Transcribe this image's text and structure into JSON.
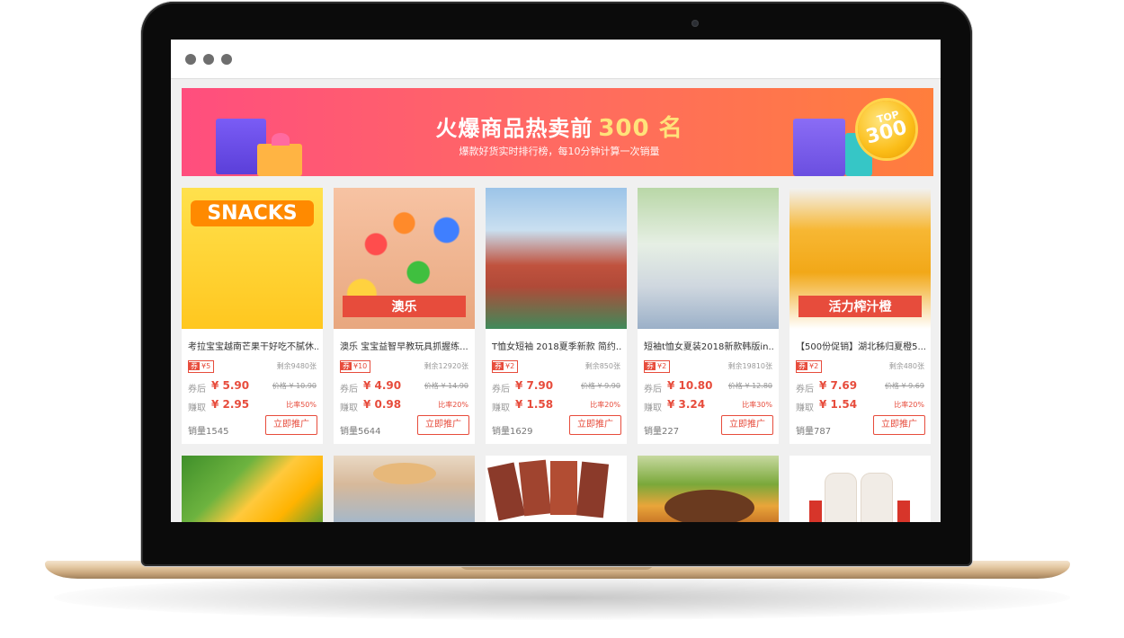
{
  "banner": {
    "title": "火爆商品热卖前",
    "title_number": "300 名",
    "subtitle": "爆款好货实时排行榜，每10分钟计算一次销量",
    "badge_top": "TOP",
    "badge_num": "300"
  },
  "labels": {
    "after_coupon": "券后",
    "earn": "赚取",
    "coupon_prefix": "券",
    "promote": "立即推广"
  },
  "products": [
    {
      "title": "考拉宝宝越南芒果干好吃不腻休...",
      "coupon": "¥5",
      "remaining": "剩余9480张",
      "price": "¥ 5.90",
      "orig": "价格 ¥ 10.90",
      "earn": "¥ 2.95",
      "rate": "比率50%",
      "sales": "销量1545",
      "thumb_text": "SNACKS"
    },
    {
      "title": "澳乐 宝宝益智早教玩具抓握练...",
      "coupon": "¥10",
      "remaining": "剩余12920张",
      "price": "¥ 4.90",
      "orig": "价格 ¥ 14.90",
      "earn": "¥ 0.98",
      "rate": "比率20%",
      "sales": "销量5644",
      "thumb_text": "澳乐"
    },
    {
      "title": "T恤女短袖 2018夏季新款 简约...",
      "coupon": "¥2",
      "remaining": "剩余850张",
      "price": "¥ 7.90",
      "orig": "价格 ¥ 9.90",
      "earn": "¥ 1.58",
      "rate": "比率20%",
      "sales": "销量1629",
      "thumb_text": ""
    },
    {
      "title": "短袖t恤女夏装2018新款韩版in...",
      "coupon": "¥2",
      "remaining": "剩余19810张",
      "price": "¥ 10.80",
      "orig": "价格 ¥ 12.80",
      "earn": "¥ 3.24",
      "rate": "比率30%",
      "sales": "销量227",
      "thumb_text": ""
    },
    {
      "title": "【500份促销】湖北秭归夏橙5...",
      "coupon": "¥2",
      "remaining": "剩余480张",
      "price": "¥ 7.69",
      "orig": "价格 ¥ 9.69",
      "earn": "¥ 1.54",
      "rate": "比率20%",
      "sales": "销量787",
      "thumb_text": "活力榨汁橙"
    }
  ],
  "colors": {
    "accent": "#e74c3c",
    "banner_start": "#ff4e7e",
    "banner_end": "#ff7e3c"
  }
}
